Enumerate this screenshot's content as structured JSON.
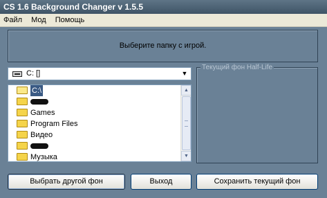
{
  "window": {
    "title": "CS 1.6 Background Changer v 1.5.5"
  },
  "menu": [
    "Файл",
    "Мод",
    "Помощь"
  ],
  "prompt": "Выберите папку с игрой.",
  "drive": {
    "icon": "drive-icon",
    "label": "C: []"
  },
  "directories": [
    {
      "label": "C:\\",
      "open": true,
      "selected": true
    },
    {
      "label": "",
      "redacted": true
    },
    {
      "label": "Games"
    },
    {
      "label": "Program Files"
    },
    {
      "label": "Видео"
    },
    {
      "label": "",
      "redacted": true
    },
    {
      "label": "Музыка"
    }
  ],
  "background_group": {
    "title": "Текущий фон Half-Life"
  },
  "buttons": {
    "change": "Выбрать другой фон",
    "exit": "Выход",
    "save": "Сохранить текущий фон"
  },
  "colors": {
    "window_bg": "#6a8196",
    "title_bar": "#3f5466",
    "selection": "#3a5a84"
  }
}
